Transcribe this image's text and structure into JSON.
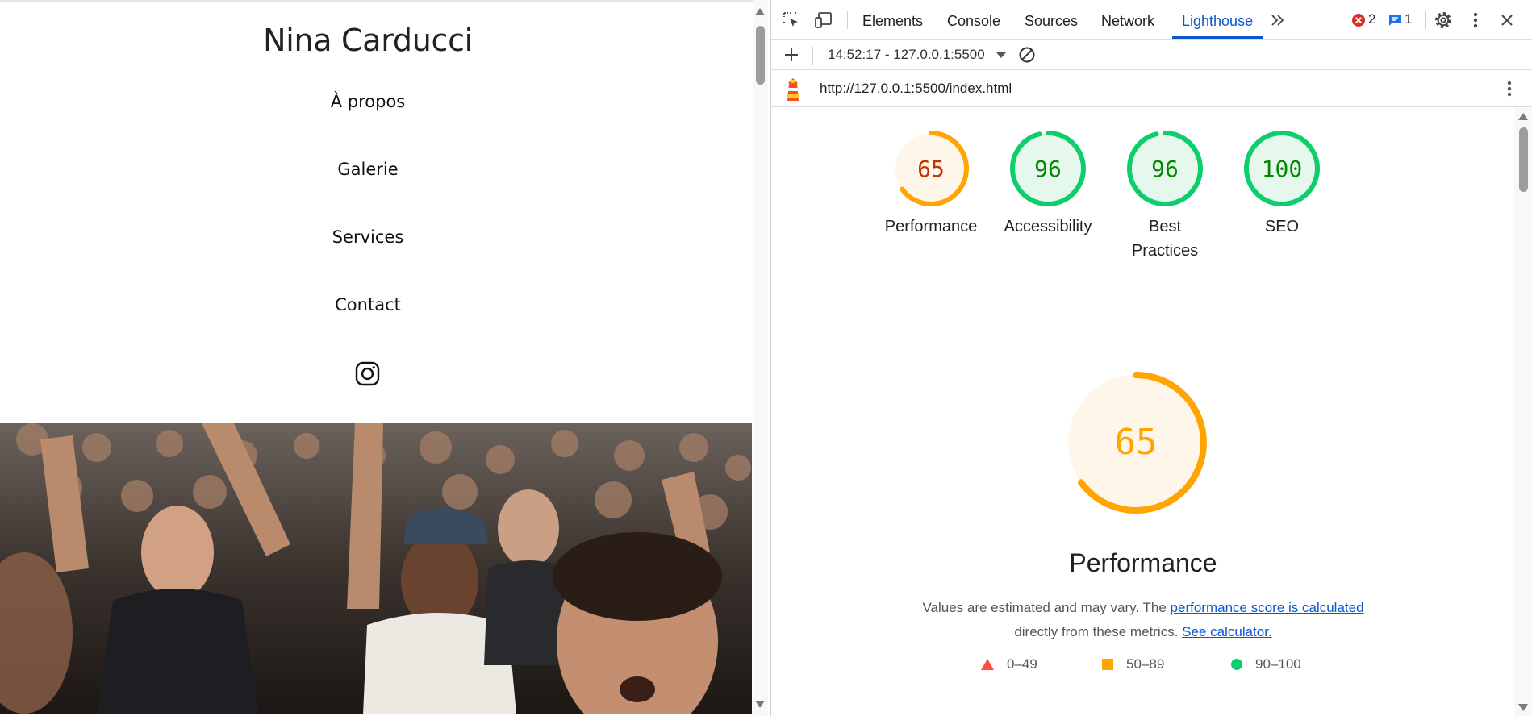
{
  "site": {
    "title": "Nina Carducci",
    "nav": [
      "À propos",
      "Galerie",
      "Services",
      "Contact"
    ],
    "instagram_icon": "instagram-icon",
    "hero_image": "concert-crowd-photo"
  },
  "devtools": {
    "tabs": [
      "Elements",
      "Console",
      "Sources",
      "Network",
      "Lighthouse"
    ],
    "active_tab": "Lighthouse",
    "error_count": "2",
    "message_count": "1",
    "report_select": "14:52:17 - 127.0.0.1:5500",
    "url": "http://127.0.0.1:5500/index.html",
    "scores": [
      {
        "label": "Performance",
        "value": 65,
        "rating": "average"
      },
      {
        "label": "Accessibility",
        "value": 96,
        "rating": "pass"
      },
      {
        "label": "Best Practices",
        "value": 96,
        "rating": "pass"
      },
      {
        "label": "SEO",
        "value": 100,
        "rating": "pass"
      }
    ],
    "performance": {
      "score": "65",
      "title": "Performance",
      "desc_prefix": "Values are estimated and may vary. The ",
      "desc_link1": "performance score is calculated",
      "desc_mid": " directly from these metrics.",
      "desc_link2": "See calculator."
    },
    "legend": [
      "0–49",
      "50–89",
      "90–100"
    ],
    "colors": {
      "accent": "#0b57d0",
      "pass": "#0cce6b",
      "pass_text": "#008800",
      "pass_fill": "#e6f8ee",
      "average": "#ffa400",
      "average_text": "#c33300",
      "average_fill": "#fff6ea",
      "fail": "#ff4e42",
      "error": "#d93025"
    }
  }
}
